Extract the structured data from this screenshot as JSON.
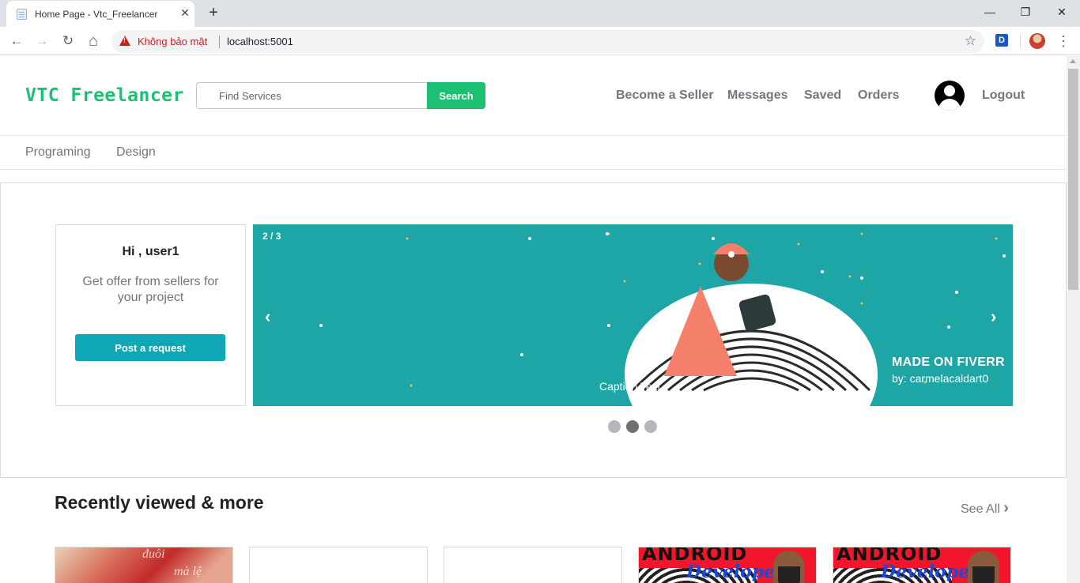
{
  "browser": {
    "tab_title": "Home Page - Vtc_Freelancer",
    "tab_close": "✕",
    "new_tab": "+",
    "window_controls": {
      "minimize": "—",
      "restore": "❐",
      "close": "✕"
    },
    "nav": {
      "back": "←",
      "forward": "→",
      "reload": "↻",
      "home": "⌂"
    },
    "security_label": "Không bảo mật",
    "url": "localhost:5001",
    "bookmark_icon": "☆",
    "extension_label": "D",
    "menu_icon": "⋮"
  },
  "header": {
    "logo": "VTC Freelancer",
    "search": {
      "placeholder": "Find Services",
      "button": "Search"
    },
    "nav_links": [
      "Become a Seller",
      "Messages",
      "Saved",
      "Orders"
    ],
    "logout": "Logout"
  },
  "categories": [
    "Programing",
    "Design"
  ],
  "welcome": {
    "greeting": "Hi , user1",
    "subtitle": "Get offer from sellers for your project",
    "button": "Post a request"
  },
  "carousel": {
    "counter": "2 / 3",
    "prev": "‹",
    "next": "›",
    "caption": "Caption Text",
    "badge_title": "MADE ON FIVERR",
    "badge_author": "by: carmelacaldart0",
    "slides": 3,
    "active_slide": 2,
    "background_color": "#1ea6a6"
  },
  "recent": {
    "title": "Recently viewed & more",
    "see_all": "See All",
    "see_all_icon": "›",
    "card1_text": [
      "đuôi",
      "mà lệ"
    ],
    "card_android_top": "ANDROID",
    "card_android_sub": "Developer"
  },
  "colors": {
    "brand": "#1dbf73",
    "request_button": "#0ea7b5",
    "security_warning": "#c5221f"
  }
}
